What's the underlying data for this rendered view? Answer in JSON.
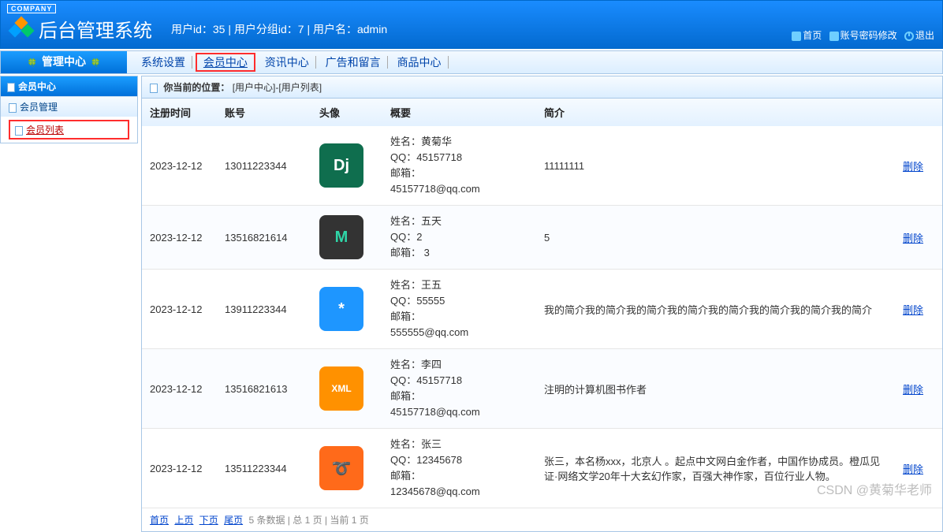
{
  "top": {
    "company_tag": "COMPANY",
    "title": "后台管理系统",
    "user_info": "用户id：35 | 用户分组id：7 | 用户名：admin",
    "links": {
      "home": "首页",
      "pwd": "账号密码修改",
      "exit": "退出"
    }
  },
  "nav": {
    "header": "管理中心",
    "items": [
      {
        "label": "系统设置",
        "active": false
      },
      {
        "label": "会员中心",
        "active": true
      },
      {
        "label": "资讯中心",
        "active": false
      },
      {
        "label": "广告和留言",
        "active": false
      },
      {
        "label": "商品中心",
        "active": false
      }
    ]
  },
  "sidebar": {
    "section": "会员中心",
    "group": "会员管理",
    "item": "会员列表"
  },
  "crumb": {
    "label": "你当前的位置：",
    "path": "[用户中心]-[用户列表]"
  },
  "table": {
    "headers": {
      "reg": "注册时间",
      "acct": "账号",
      "avatar": "头像",
      "summary": "概要",
      "intro": "简介",
      "op": ""
    },
    "summary_labels": {
      "name": "姓名：",
      "qq": "QQ：",
      "mail": "邮箱："
    },
    "delete_label": "删除",
    "rows": [
      {
        "reg": "2023-12-12",
        "acct": "13011223344",
        "avatar_text": "Dj",
        "avatar_bg": "#0f6e4e",
        "name": "黄菊华",
        "qq": "45157718",
        "mail": "45157718@qq.com",
        "intro": "11111111"
      },
      {
        "reg": "2023-12-12",
        "acct": "13516821614",
        "avatar_text": "M",
        "avatar_bg": "#333333",
        "avatar_fg": "#2fd6a8",
        "name": "五天",
        "qq": "2",
        "mail": "3",
        "intro": "5"
      },
      {
        "reg": "2023-12-12",
        "acct": "13911223344",
        "avatar_text": "*",
        "avatar_bg": "#1e96ff",
        "name": "王五",
        "qq": "55555",
        "mail": "555555@qq.com",
        "intro": "我的简介我的简介我的简介我的简介我的简介我的简介我的简介我的简介"
      },
      {
        "reg": "2023-12-12",
        "acct": "13516821613",
        "avatar_text": "XML",
        "avatar_bg": "#ff9100",
        "avatar_fs": "12px",
        "name": "李四",
        "qq": "45157718",
        "mail": "45157718@qq.com",
        "intro": "注明的计算机图书作者"
      },
      {
        "reg": "2023-12-12",
        "acct": "13511223344",
        "avatar_text": "➰",
        "avatar_bg": "#ff6a1a",
        "name": "张三",
        "qq": "12345678",
        "mail": "12345678@qq.com",
        "intro": "张三，本名杨xxx，北京人 。起点中文网白金作者，中国作协成员。橙瓜见证·网络文学20年十大玄幻作家，百强大神作家，百位行业人物。"
      }
    ]
  },
  "pager": {
    "first": "首页",
    "prev": "上页",
    "next": "下页",
    "last": "尾页",
    "info": "5 条数据 | 总 1 页 | 当前 1 页"
  },
  "watermark": "CSDN @黄菊华老师"
}
